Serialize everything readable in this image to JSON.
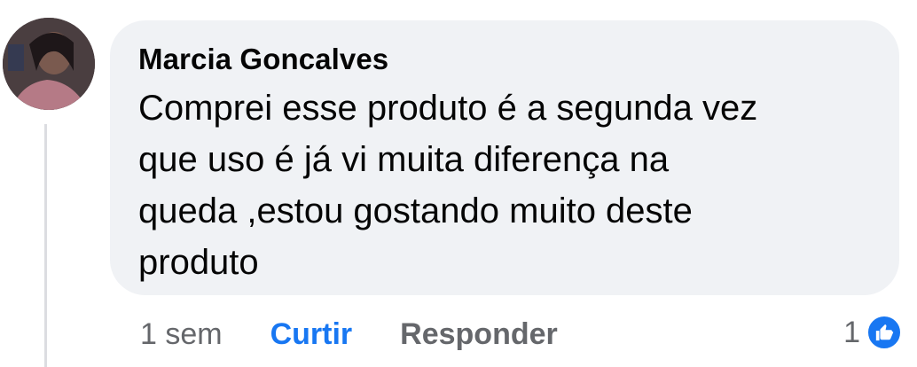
{
  "comment": {
    "author": "Marcia Goncalves",
    "text_lines": [
      "Comprei esse produto é a segunda vez",
      "que uso é já vi muita diferença na",
      "queda ,estou gostando muito deste",
      "produto"
    ],
    "timestamp": "1 sem",
    "like_label": "Curtir",
    "reply_label": "Responder",
    "reaction_count": "1",
    "reaction_icon": "thumbs-up-icon"
  },
  "colors": {
    "bubble_bg": "#f0f2f5",
    "accent_blue": "#1877f2",
    "muted_text": "#65676b",
    "primary_text": "#050505"
  }
}
